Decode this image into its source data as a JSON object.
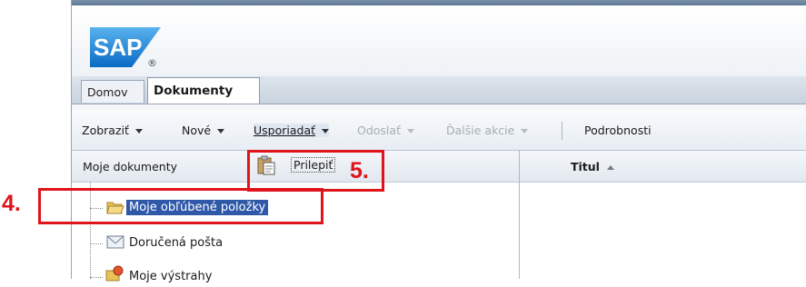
{
  "header": {
    "logo_text": "SAP",
    "logo_mark": "®"
  },
  "tabs": [
    {
      "label": "Domov",
      "selected": false
    },
    {
      "label": "Dokumenty",
      "selected": true
    }
  ],
  "toolbar": {
    "items": [
      {
        "label": "Zobraziť",
        "dropdown": true,
        "enabled": true
      },
      {
        "label": "Nové",
        "dropdown": true,
        "enabled": true
      },
      {
        "label": "Usporiadať",
        "dropdown": true,
        "enabled": true,
        "active": true
      },
      {
        "label": "Odoslať",
        "dropdown": true,
        "enabled": false
      },
      {
        "label": "Ďalšie akcie",
        "dropdown": true,
        "enabled": false
      },
      {
        "label": "Podrobnosti",
        "dropdown": false,
        "enabled": true
      }
    ]
  },
  "left_pane": {
    "title": "Moje dokumenty",
    "paste_label": "Prilepiť",
    "tree": [
      {
        "label": "Moje obľúbené položky",
        "icon": "folder-open-icon",
        "selected": true
      },
      {
        "label": "Doručená pošta",
        "icon": "inbox-icon",
        "selected": false
      },
      {
        "label": "Moje výstrahy",
        "icon": "alerts-icon",
        "selected": false
      }
    ]
  },
  "right_pane": {
    "column_header": "Titul",
    "sort": "ascending"
  },
  "annotations": {
    "step4": "4.",
    "step5": "5.",
    "color": "#e0141b"
  },
  "colors": {
    "sap_blue": "#0a6bc4",
    "selection": "#2f58a8"
  }
}
